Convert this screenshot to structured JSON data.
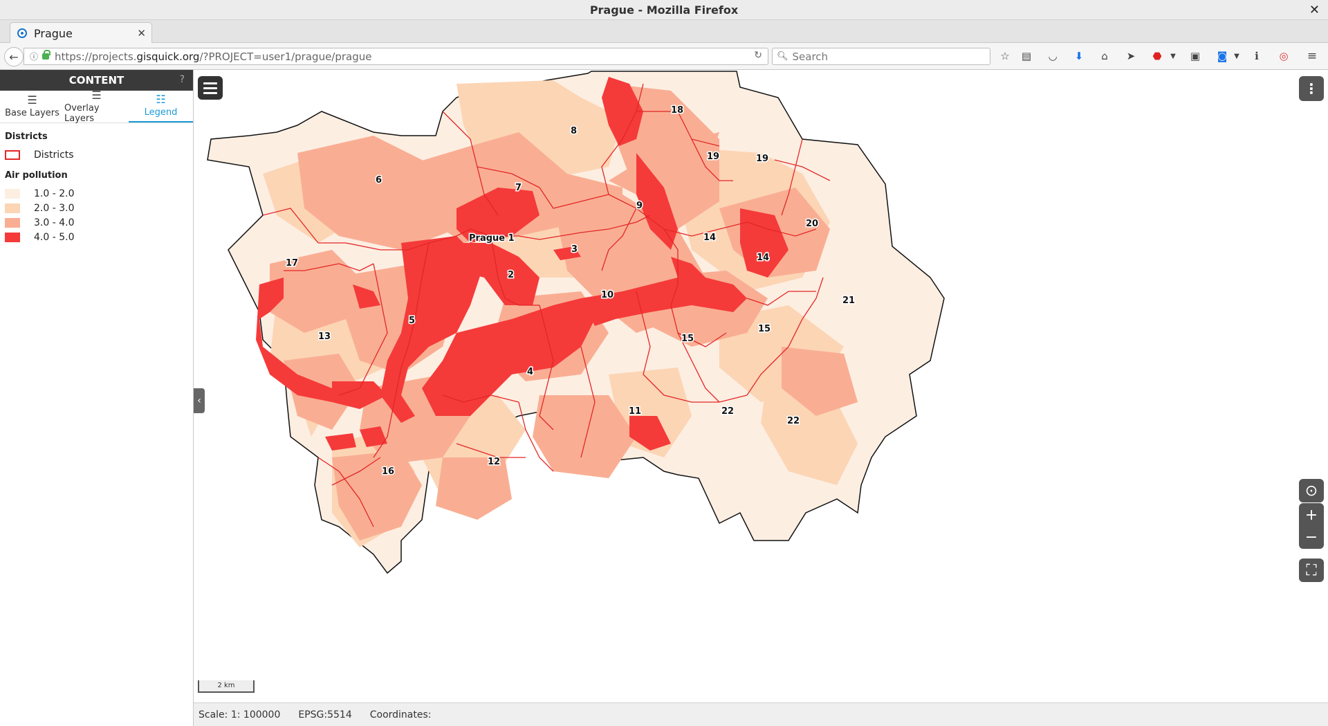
{
  "window": {
    "title": "Prague - Mozilla Firefox"
  },
  "tab": {
    "label": "Prague"
  },
  "url": {
    "prefix": "https://projects.",
    "host": "gisquick.org",
    "path": "/?PROJECT=user1/prague/prague"
  },
  "search": {
    "placeholder": "Search"
  },
  "sidebar": {
    "header": "CONTENT",
    "help": "?",
    "tabs": [
      {
        "label": "Base Layers",
        "icon": "layers-icon"
      },
      {
        "label": "Overlay Layers",
        "icon": "layers-icon"
      },
      {
        "label": "Legend",
        "icon": "list-icon"
      }
    ],
    "active_tab": "Legend"
  },
  "legend": {
    "districts_title": "Districts",
    "districts_item": "Districts",
    "districts_color": "#e32626",
    "air_title": "Air pollution",
    "classes": [
      {
        "label": "1.0 - 2.0",
        "color": "#fdeee2"
      },
      {
        "label": "2.0 - 3.0",
        "color": "#fcd5b5"
      },
      {
        "label": "3.0 - 4.0",
        "color": "#f9ae93"
      },
      {
        "label": "4.0 - 5.0",
        "color": "#f53a3a"
      }
    ]
  },
  "map": {
    "district_labels": [
      "Prague 1",
      "2",
      "3",
      "4",
      "5",
      "6",
      "7",
      "8",
      "9",
      "10",
      "11",
      "12",
      "13",
      "14",
      "14",
      "15",
      "15",
      "16",
      "17",
      "18",
      "19",
      "19",
      "20",
      "21",
      "22",
      "22"
    ],
    "scale_label": "2 km"
  },
  "status": {
    "scale": "Scale: 1: 100000",
    "epsg": "EPSG:5514",
    "coordinates": "Coordinates:"
  }
}
